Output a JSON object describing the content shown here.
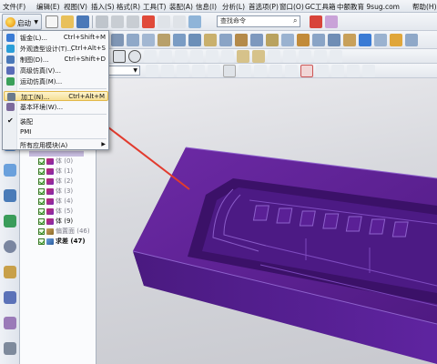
{
  "menubar": {
    "items": [
      "文件(F)",
      "编辑(E)",
      "视图(V)",
      "插入(S)",
      "格式(R)",
      "工具(T)",
      "装配(A)",
      "信息(I)",
      "分析(L)",
      "首选项(P)",
      "窗口(O)",
      "GC工具箱",
      "中额教育 9sug.com",
      "帮助(H)"
    ]
  },
  "toolbar": {
    "start_label": "启动",
    "start_icon": "gear-icon",
    "command_search_value": "查找命令",
    "type_filter_value": ""
  },
  "start_menu": {
    "items": [
      {
        "label": "钣金(L)...",
        "shortcut": "Ctrl+Shift+M",
        "icon": "sheet-metal-icon",
        "color": "#3a7bd5"
      },
      {
        "label": "外观造型设计(T)...",
        "shortcut": "Ctrl+Alt+S",
        "icon": "shape-studio-icon",
        "color": "#2b9ed8"
      },
      {
        "label": "制图(D)...",
        "shortcut": "Ctrl+Shift+D",
        "icon": "drafting-icon",
        "color": "#4a78b8"
      },
      {
        "label": "高级仿真(V)...",
        "shortcut": "",
        "icon": "advanced-simulation-icon",
        "color": "#5a6cb8"
      },
      {
        "label": "运动仿真(M)...",
        "shortcut": "",
        "icon": "motion-simulation-icon",
        "color": "#3aa05a"
      },
      {
        "label": "加工(N)...",
        "shortcut": "Ctrl+Alt+M",
        "icon": "manufacturing-icon",
        "color": "#6b7a8c",
        "highlighted": true
      },
      {
        "label": "基本环境(W)...",
        "shortcut": "",
        "icon": "gateway-icon",
        "color": "#7c6a9c"
      },
      {
        "label": "装配",
        "shortcut": "",
        "icon": "",
        "checked": true
      },
      {
        "label": "PMI",
        "shortcut": "",
        "icon": ""
      },
      {
        "label": "所有应用模块(A)",
        "shortcut": "",
        "icon": "",
        "submenu": true
      }
    ]
  },
  "navigator": {
    "items": [
      {
        "label": "体 (0)",
        "bold": false
      },
      {
        "label": "体 (1)",
        "bold": false
      },
      {
        "label": "体 (2)",
        "bold": false
      },
      {
        "label": "体 (3)",
        "bold": false
      },
      {
        "label": "体 (4)",
        "bold": false
      },
      {
        "label": "体 (5)",
        "bold": false
      },
      {
        "label": "体 (9)",
        "bold": false
      },
      {
        "label": "偏置面 (46)",
        "bold": false
      },
      {
        "label": "求差 (47)",
        "bold": true
      }
    ]
  },
  "viewport": {
    "model_color": "#5b1f8c",
    "arrow_color": "#e23b2e"
  }
}
